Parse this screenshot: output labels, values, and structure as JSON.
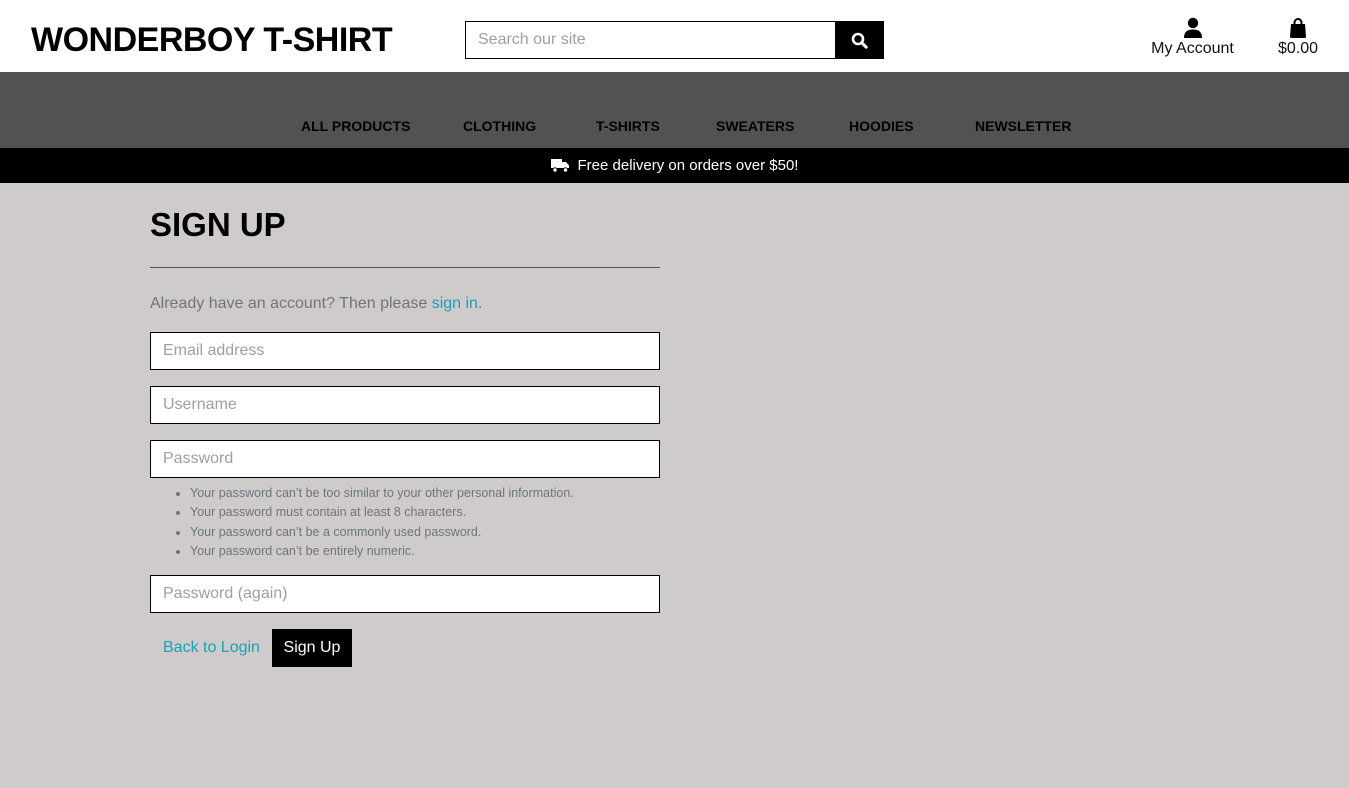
{
  "header": {
    "logo": "WONDERBOY T-SHIRT",
    "search_placeholder": "Search our site",
    "account_label": "My Account",
    "bag_total": "$0.00"
  },
  "nav": {
    "items": [
      "ALL PRODUCTS",
      "CLOTHING",
      "T-SHIRTS",
      "SWEATERS",
      "HOODIES",
      "NEWSLETTER"
    ]
  },
  "banner": {
    "text": "Free delivery on orders over $50!"
  },
  "form": {
    "title": "SIGN UP",
    "intro_prefix": "Already have an account? Then please ",
    "intro_link": "sign in",
    "intro_suffix": ".",
    "email_placeholder": "Email address",
    "username_placeholder": "Username",
    "password_placeholder": "Password",
    "password2_placeholder": "Password (again)",
    "password_help": [
      "Your password can’t be too similar to your other personal information.",
      "Your password must contain at least 8 characters.",
      "Your password can’t be a commonly used password.",
      "Your password can’t be entirely numeric."
    ],
    "back_link": "Back to Login",
    "submit_label": "Sign Up"
  },
  "colors": {
    "page_bg": "#cfcbca",
    "nav_bg": "#515252",
    "banner_bg": "#000000",
    "link": "#17a2b8",
    "button_bg": "#000000"
  },
  "icons": [
    "search-icon",
    "user-icon",
    "shopping-bag-icon",
    "truck-icon"
  ]
}
